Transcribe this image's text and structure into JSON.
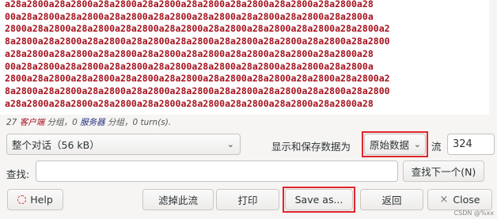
{
  "stream": {
    "lines": [
      "a28a2800a28a2800a28a2800a28a2800a28a2800a28a2800a28a2800a28a2800a28",
      "00a28a2800a28a2800a28a2800a28a2800a28a2800a28a2800a28a2800a28a2800a",
      "2800a28a2800a28a2800a28a2800a28a2800a28a2800a28a2800a28a2800a28a2800a2",
      "8a2800a28a2800a28a2800a28a2800a28a2800a28a2800a28a2800a28a2800a28a2800",
      "a28a2800a28a2800a28a2800a28a2800a28a2800a28a2800a28a2800a28a2800a28",
      "00a28a2800a28a2800a28a2800a28a2800a28a2800a28a2800a28a2800a28a2800a",
      "2800a28a2800a28a2800a28a2800a28a2800a28a2800a28a2800a28a2800a28a2800a2",
      "8a2800a28a2800a28a2800a28a2800a28a2800a28a2800a28a2800a28a2800a28a2800",
      "a28a2800a28a2800a28a2800a28a2800a28a2800a28a2800a28a2800a28a2800a28"
    ]
  },
  "summary": {
    "client_count": "27",
    "client_label": "客户端",
    "client_suffix": " 分组，",
    "server_count": "0",
    "server_label": "服务器",
    "server_suffix": " 分组，",
    "turns": "0 turn(s)."
  },
  "controls": {
    "conversation_select": "整个对话（56 kB）",
    "show_save_label": "显示和保存数据为",
    "format_select": "原始数据",
    "stream_label": "流",
    "stream_value": "324"
  },
  "find": {
    "label": "查找:",
    "value": "",
    "find_next": "查找下一个(N)"
  },
  "buttons": {
    "help": "Help",
    "filter_out": "滤掉此流",
    "print": "打印",
    "save_as": "Save as...",
    "back": "返回",
    "close": "Close"
  },
  "icons": {
    "help": "help-icon",
    "close": "close-icon",
    "chevron": "chevron-down-icon"
  },
  "colors": {
    "client_text": "#a6121e",
    "server_text": "#1c2b7e",
    "highlight_frame": "#e0262b"
  },
  "watermark": "CSDN @%xx"
}
